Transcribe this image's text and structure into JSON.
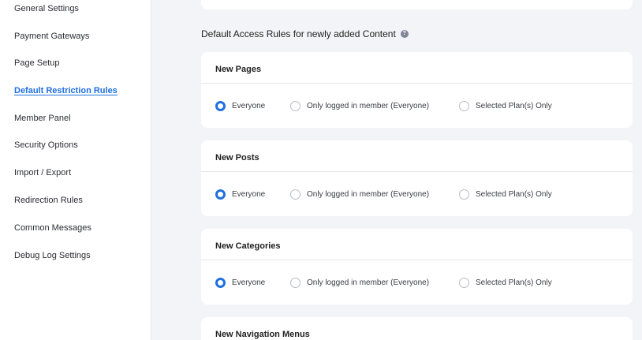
{
  "sidebar": {
    "items": [
      {
        "label": "General Settings"
      },
      {
        "label": "Payment Gateways"
      },
      {
        "label": "Page Setup"
      },
      {
        "label": "Default Restriction Rules"
      },
      {
        "label": "Member Panel"
      },
      {
        "label": "Security Options"
      },
      {
        "label": "Import / Export"
      },
      {
        "label": "Redirection Rules"
      },
      {
        "label": "Common Messages"
      },
      {
        "label": "Debug Log Settings"
      }
    ],
    "active": "Default Restriction Rules"
  },
  "main": {
    "section_heading": "Default Access Rules for newly added Content",
    "help_icon": "question-icon",
    "cards": [
      {
        "title": "New Pages",
        "options": [
          "Everyone",
          "Only logged in member (Everyone)",
          "Selected Plan(s) Only"
        ],
        "selected": "Everyone"
      },
      {
        "title": "New Posts",
        "options": [
          "Everyone",
          "Only logged in member (Everyone)",
          "Selected Plan(s) Only"
        ],
        "selected": "Everyone"
      },
      {
        "title": "New Categories",
        "options": [
          "Everyone",
          "Only logged in member (Everyone)",
          "Selected Plan(s) Only"
        ],
        "selected": "Everyone"
      },
      {
        "title": "New Navigation Menus"
      }
    ]
  },
  "colors": {
    "accent": "#1f6fe0",
    "background": "#f3f4f7",
    "card": "#ffffff"
  }
}
